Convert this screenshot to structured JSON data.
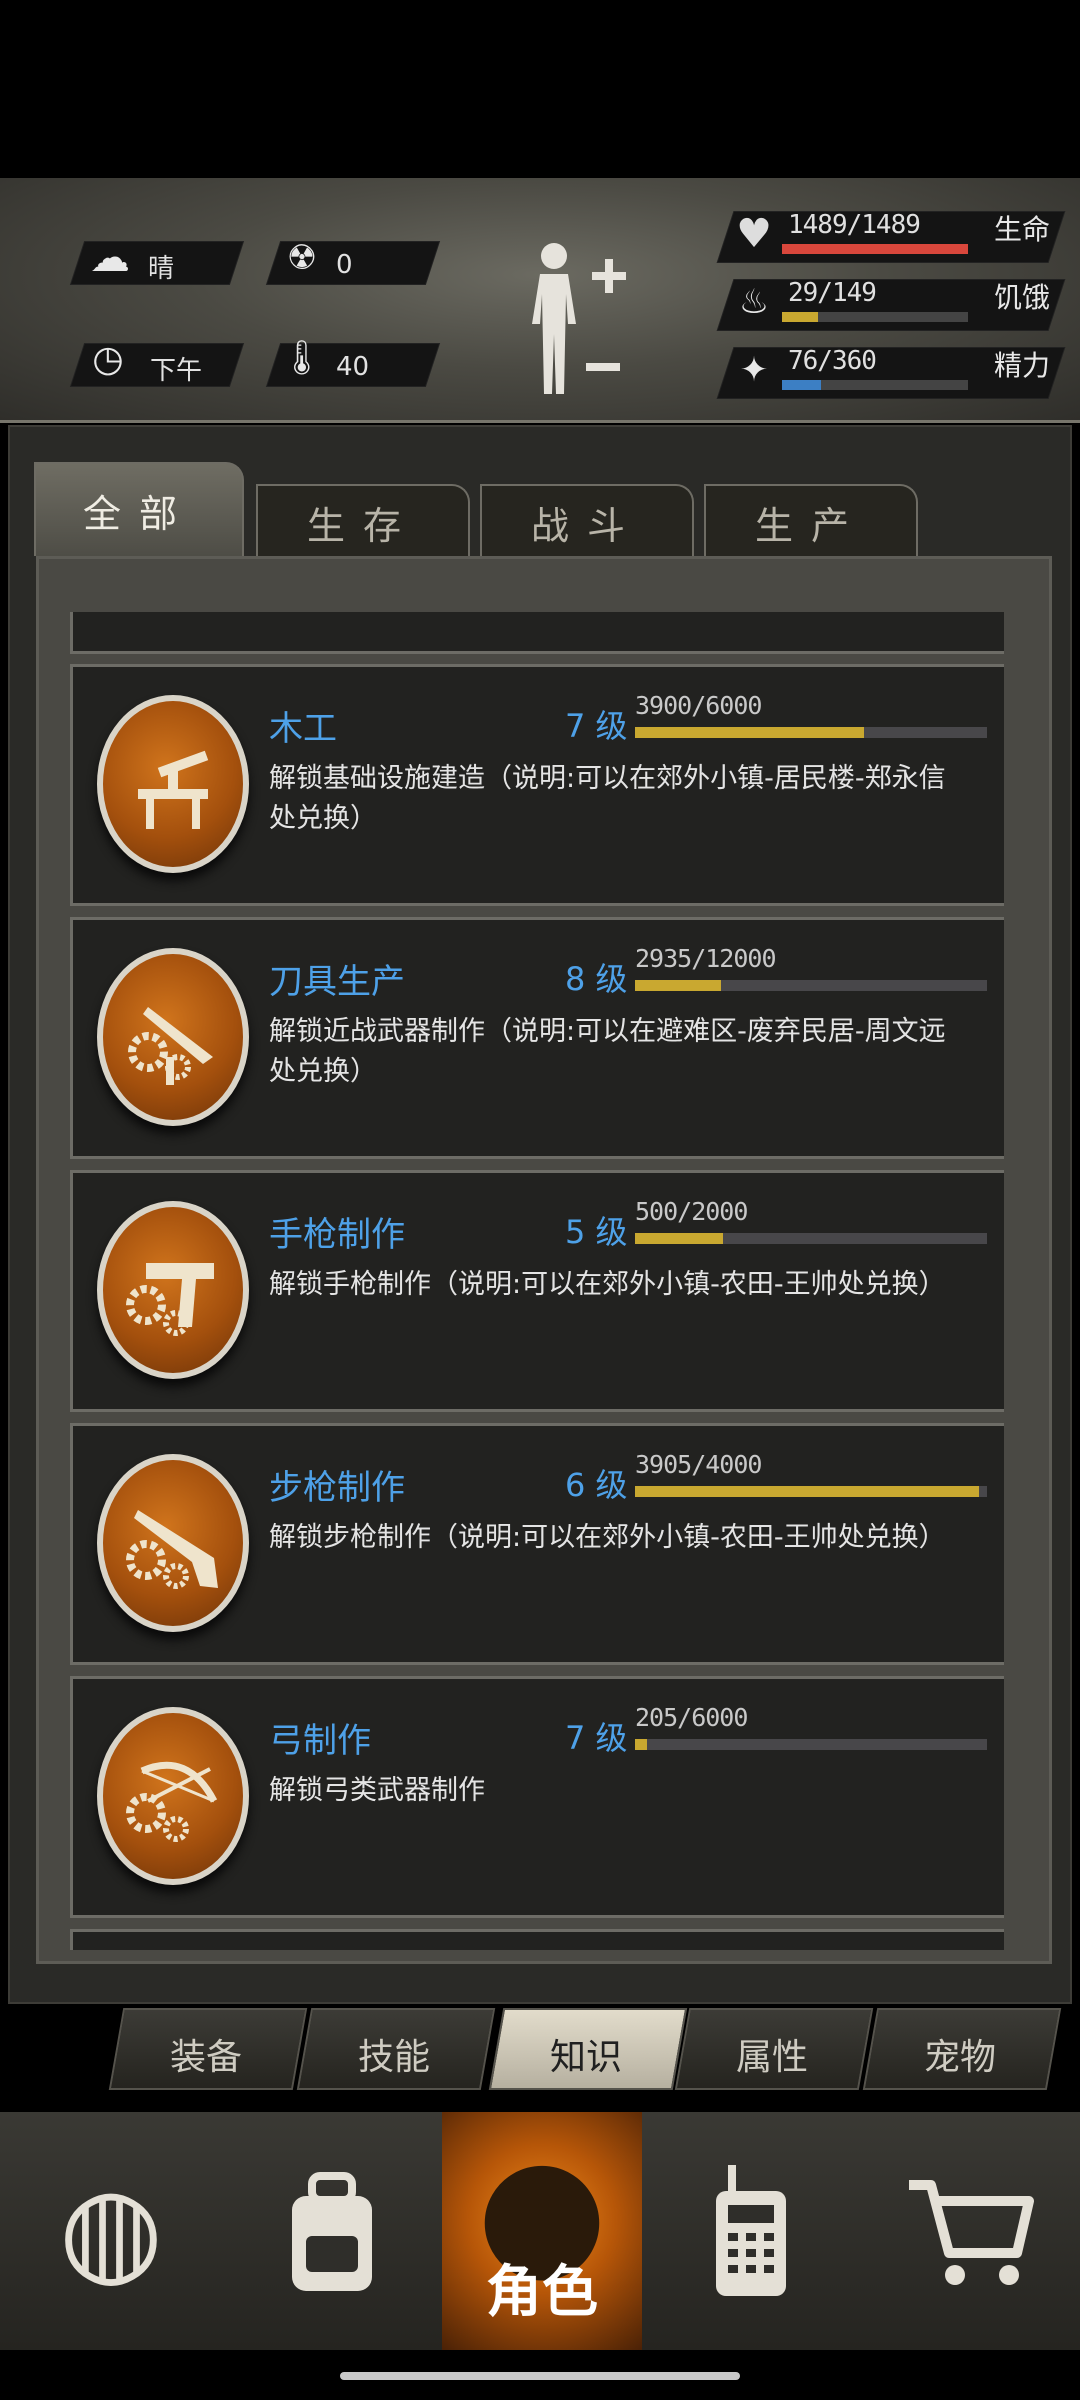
{
  "status": {
    "weather": "晴",
    "radiation": "0",
    "time_of_day": "下午",
    "temperature": "40",
    "health": {
      "value": "1489/1489",
      "label": "生命",
      "fraction": 1.0,
      "color": "#d9473c"
    },
    "hunger": {
      "value": "29/149",
      "label": "饥饿",
      "fraction": 0.195,
      "color": "#c9a830"
    },
    "energy": {
      "value": "76/360",
      "label": "精力",
      "fraction": 0.211,
      "color": "#3c7fc4"
    }
  },
  "tabs": [
    {
      "label": "全部",
      "active": true
    },
    {
      "label": "生存",
      "active": false
    },
    {
      "label": "战斗",
      "active": false
    },
    {
      "label": "生产",
      "active": false
    }
  ],
  "knowledge": [
    {
      "title": "木工",
      "level": "7 级",
      "xp": "3900/6000",
      "progress": 0.65,
      "desc": "解锁基础设施建造（说明:可以在郊外小镇-居民楼-郑永信处兑换）",
      "icon": "carpentry-icon"
    },
    {
      "title": "刀具生产",
      "level": "8 级",
      "xp": "2935/12000",
      "progress": 0.245,
      "desc": "解锁近战武器制作（说明:可以在避难区-废弃民居-周文远处兑换）",
      "icon": "knife-icon"
    },
    {
      "title": "手枪制作",
      "level": "5 级",
      "xp": "500/2000",
      "progress": 0.25,
      "desc": "解锁手枪制作（说明:可以在郊外小镇-农田-王帅处兑换）",
      "icon": "pistol-icon"
    },
    {
      "title": "步枪制作",
      "level": "6 级",
      "xp": "3905/4000",
      "progress": 0.976,
      "desc": "解锁步枪制作（说明:可以在郊外小镇-农田-王帅处兑换）",
      "icon": "rifle-icon"
    },
    {
      "title": "弓制作",
      "level": "7 级",
      "xp": "205/6000",
      "progress": 0.034,
      "desc": "解锁弓类武器制作",
      "icon": "bow-icon"
    }
  ],
  "subtabs": [
    {
      "label": "装备",
      "active": false
    },
    {
      "label": "技能",
      "active": false
    },
    {
      "label": "知识",
      "active": true
    },
    {
      "label": "属性",
      "active": false
    },
    {
      "label": "宠物",
      "active": false
    }
  ],
  "bottomnav": [
    {
      "icon": "globe-icon",
      "label": "",
      "active": false
    },
    {
      "icon": "backpack-icon",
      "label": "",
      "active": false
    },
    {
      "icon": "character-icon",
      "label": "角色",
      "active": true
    },
    {
      "icon": "walkie-talkie-icon",
      "label": "",
      "active": false
    },
    {
      "icon": "cart-icon",
      "label": "",
      "active": false
    }
  ]
}
